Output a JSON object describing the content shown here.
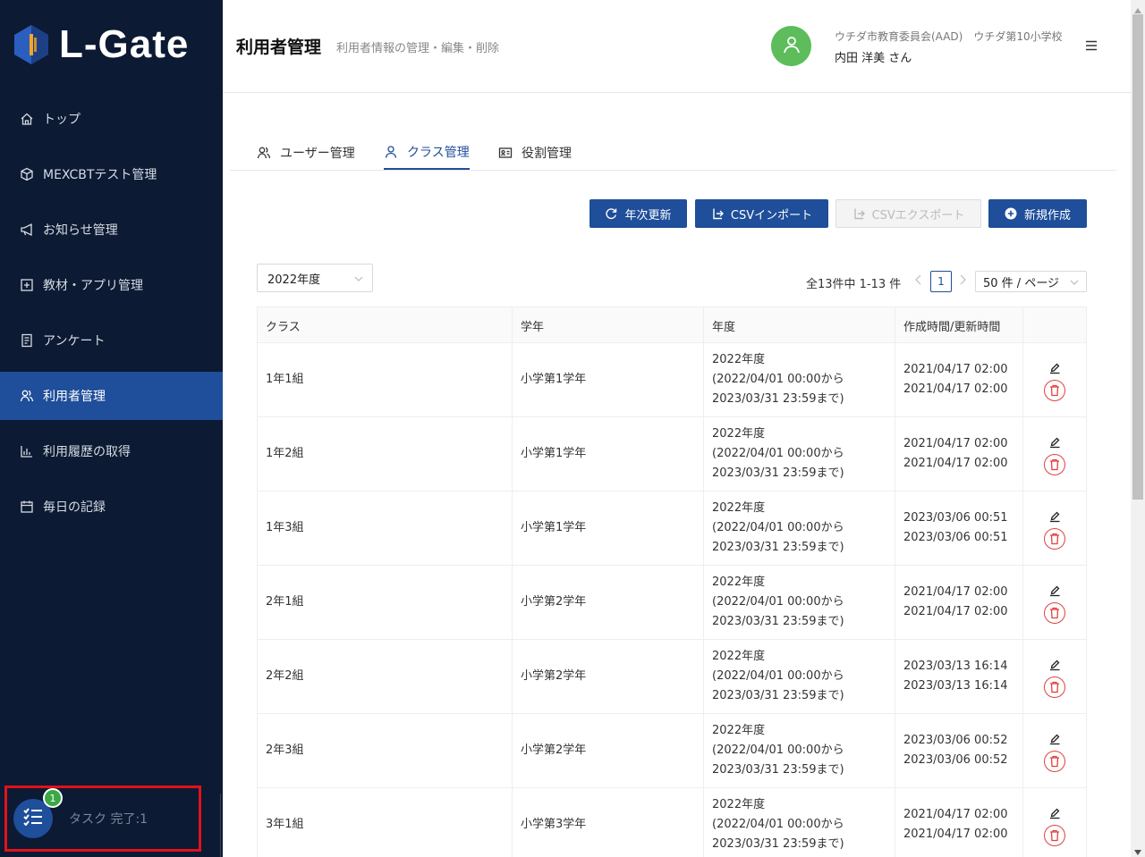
{
  "app": {
    "logo_text": "L-Gate"
  },
  "sidebar": {
    "items": [
      {
        "label": "トップ",
        "icon": "home-icon"
      },
      {
        "label": "MEXCBTテスト管理",
        "icon": "cube-icon"
      },
      {
        "label": "お知らせ管理",
        "icon": "megaphone-icon"
      },
      {
        "label": "教材・アプリ管理",
        "icon": "plus-square-icon"
      },
      {
        "label": "アンケート",
        "icon": "survey-icon"
      },
      {
        "label": "利用者管理",
        "icon": "users-icon",
        "active": true
      },
      {
        "label": "利用履歴の取得",
        "icon": "bar-chart-icon"
      },
      {
        "label": "毎日の記録",
        "icon": "calendar-icon"
      }
    ],
    "task": {
      "badge": "1",
      "label": "タスク 完了:1"
    }
  },
  "header": {
    "title": "利用者管理",
    "subtitle": "利用者情報の管理・編集・削除",
    "org": "ウチダ市教育委員会(AAD)　ウチダ第10小学校",
    "user": "内田 洋美 さん"
  },
  "tabs": [
    {
      "label": "ユーザー管理",
      "icon": "users-icon"
    },
    {
      "label": "クラス管理",
      "icon": "user-icon",
      "active": true
    },
    {
      "label": "役割管理",
      "icon": "id-card-icon"
    }
  ],
  "toolbar": {
    "annual_update": "年次更新",
    "csv_import": "CSVインポート",
    "csv_export": "CSVエクスポート",
    "new_create": "新規作成"
  },
  "filter": {
    "year": "2022年度"
  },
  "pagination": {
    "total": "全13件中 1-13 件",
    "page": "1",
    "page_size": "50 件 / ページ"
  },
  "table": {
    "headers": [
      "クラス",
      "学年",
      "年度",
      "作成時間/更新時間"
    ],
    "rows": [
      {
        "class": "1年1組",
        "grade": "小学第1学年",
        "year": "2022年度",
        "range1": "(2022/04/01 00:00から",
        "range2": "2023/03/31 23:59まで)",
        "created": "2021/04/17 02:00",
        "updated": "2021/04/17 02:00"
      },
      {
        "class": "1年2組",
        "grade": "小学第1学年",
        "year": "2022年度",
        "range1": "(2022/04/01 00:00から",
        "range2": "2023/03/31 23:59まで)",
        "created": "2021/04/17 02:00",
        "updated": "2021/04/17 02:00"
      },
      {
        "class": "1年3組",
        "grade": "小学第1学年",
        "year": "2022年度",
        "range1": "(2022/04/01 00:00から",
        "range2": "2023/03/31 23:59まで)",
        "created": "2023/03/06 00:51",
        "updated": "2023/03/06 00:51"
      },
      {
        "class": "2年1組",
        "grade": "小学第2学年",
        "year": "2022年度",
        "range1": "(2022/04/01 00:00から",
        "range2": "2023/03/31 23:59まで)",
        "created": "2021/04/17 02:00",
        "updated": "2021/04/17 02:00"
      },
      {
        "class": "2年2組",
        "grade": "小学第2学年",
        "year": "2022年度",
        "range1": "(2022/04/01 00:00から",
        "range2": "2023/03/31 23:59まで)",
        "created": "2023/03/13 16:14",
        "updated": "2023/03/13 16:14"
      },
      {
        "class": "2年3組",
        "grade": "小学第2学年",
        "year": "2022年度",
        "range1": "(2022/04/01 00:00から",
        "range2": "2023/03/31 23:59まで)",
        "created": "2023/03/06 00:52",
        "updated": "2023/03/06 00:52"
      },
      {
        "class": "3年1組",
        "grade": "小学第3学年",
        "year": "2022年度",
        "range1": "(2022/04/01 00:00から",
        "range2": "2023/03/31 23:59まで)",
        "created": "2021/04/17 02:00",
        "updated": "2021/04/17 02:00"
      }
    ]
  },
  "colors": {
    "sidebar_bg": "#0c1a33",
    "accent": "#1f4e9a",
    "avatar": "#5cbd5a",
    "danger": "#e04040",
    "task_highlight": "#e0121a"
  }
}
